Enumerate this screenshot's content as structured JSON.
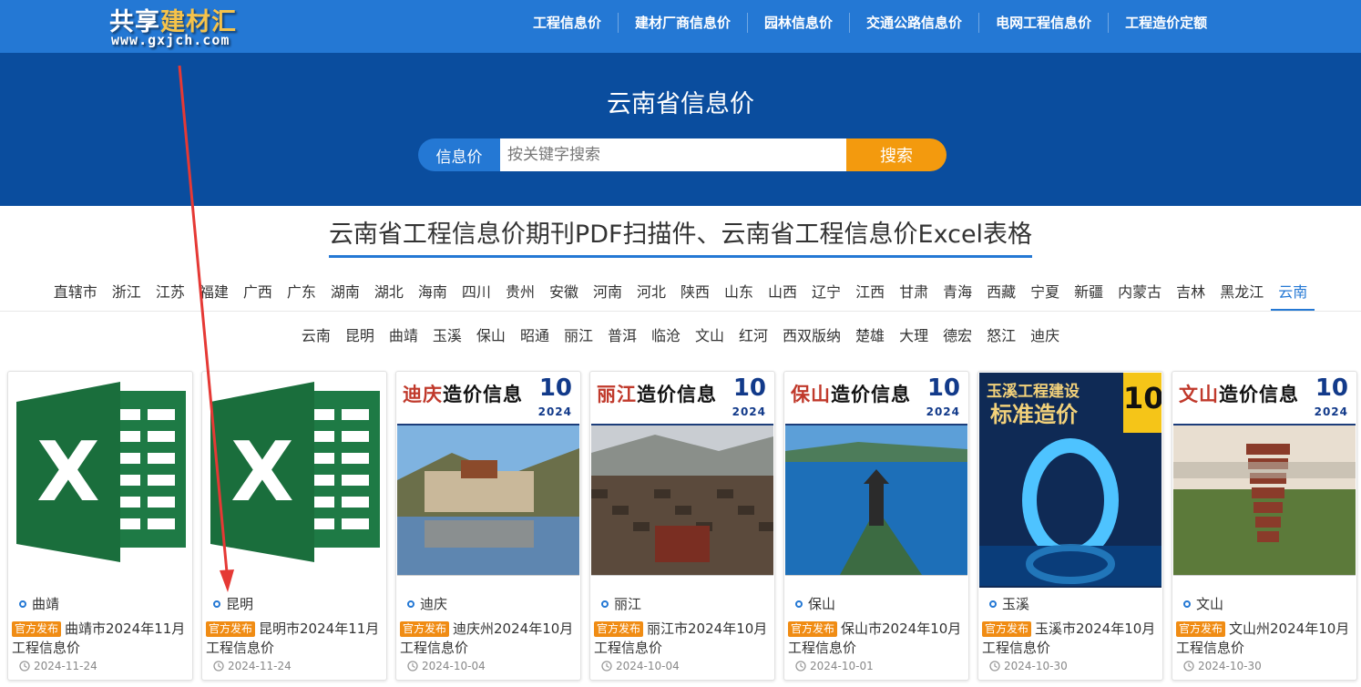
{
  "logo": {
    "cn_part1": "共享",
    "cn_part2": "建材汇",
    "url": "www.gxjch.com"
  },
  "topnav": [
    "工程信息价",
    "建材厂商信息价",
    "园林信息价",
    "交通公路信息价",
    "电网工程信息价",
    "工程造价定额"
  ],
  "hero": {
    "title": "云南省信息价",
    "search_tag": "信息价",
    "search_placeholder": "按关键字搜索",
    "search_button": "搜索"
  },
  "section_title": "云南省工程信息价期刊PDF扫描件、云南省工程信息价Excel表格",
  "provinces": [
    "直辖市",
    "浙江",
    "江苏",
    "福建",
    "广西",
    "广东",
    "湖南",
    "湖北",
    "海南",
    "四川",
    "贵州",
    "安徽",
    "河南",
    "河北",
    "陕西",
    "山东",
    "山西",
    "辽宁",
    "江西",
    "甘肃",
    "青海",
    "西藏",
    "宁夏",
    "新疆",
    "内蒙古",
    "吉林",
    "黑龙江",
    "云南"
  ],
  "active_province": "云南",
  "cities": [
    "云南",
    "昆明",
    "曲靖",
    "玉溪",
    "保山",
    "昭通",
    "丽江",
    "普洱",
    "临沧",
    "文山",
    "红河",
    "西双版纳",
    "楚雄",
    "大理",
    "德宏",
    "怒江",
    "迪庆"
  ],
  "badge_label": "官方发布",
  "cards": [
    {
      "type": "excel",
      "city": "曲靖",
      "title": "曲靖市2024年11月工程信息价",
      "date": "2024-11-24"
    },
    {
      "type": "excel",
      "city": "昆明",
      "title": "昆明市2024年11月工程信息价",
      "date": "2024-11-24"
    },
    {
      "type": "cover",
      "cover_name_a": "迪庆",
      "cover_name_b": "造价信息",
      "cover_num": "10",
      "cover_year": "2024",
      "scene": "monastery",
      "city": "迪庆",
      "title": "迪庆州2024年10月工程信息价",
      "date": "2024-10-04"
    },
    {
      "type": "cover",
      "cover_name_a": "丽江",
      "cover_name_b": "造价信息",
      "cover_num": "10",
      "cover_year": "2024",
      "scene": "oldtown",
      "city": "丽江",
      "title": "丽江市2024年10月工程信息价",
      "date": "2024-10-04"
    },
    {
      "type": "cover",
      "cover_name_a": "保山",
      "cover_name_b": "造价信息",
      "cover_num": "10",
      "cover_year": "2024",
      "scene": "lake",
      "city": "保山",
      "title": "保山市2024年10月工程信息价",
      "date": "2024-10-01"
    },
    {
      "type": "cover-yuxi",
      "cover_name_a": "玉溪工程建设",
      "cover_name_b": "标准造价",
      "cover_num": "10",
      "scene": "ring",
      "city": "玉溪",
      "title": "玉溪市2024年10月工程信息价",
      "date": "2024-10-30"
    },
    {
      "type": "cover",
      "cover_name_a": "文山",
      "cover_name_b": "造价信息",
      "cover_num": "10",
      "cover_year": "2024",
      "scene": "pagoda",
      "city": "文山",
      "title": "文山州2024年10月工程信息价",
      "date": "2024-10-30"
    }
  ],
  "colors": {
    "nav_blue": "#2478d4",
    "hero_blue": "#0a4d9e",
    "search_orange": "#f39a0e",
    "badge_orange": "#f08c14",
    "excel_green": "#1e7a45",
    "arrow_red": "#e53935"
  }
}
